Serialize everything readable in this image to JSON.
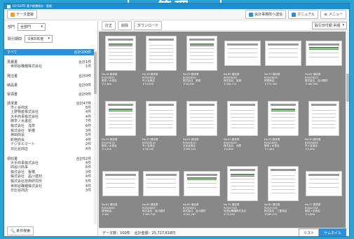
{
  "banner": {
    "title": "管理"
  },
  "window": {
    "title": "DX-SUITE 電子帳簿保存 - 管理"
  },
  "toolbar": {
    "register_label": "データ登録",
    "send_accounting_label": "会計事務所へ送信",
    "manual_label": "マニュアル",
    "menu_label": "メニュー"
  },
  "sidebar": {
    "dept_label": "部門",
    "dept_value": "全部門",
    "period_label": "取引期間",
    "period_value": "令和5年度",
    "all_label": "すべて",
    "all_count": "合計100件",
    "groups": [
      {
        "name": "見積書",
        "count": "合計1件",
        "items": [
          {
            "name": "世田谷職種株式会社",
            "count": "1件"
          }
        ]
      },
      {
        "name": "発注書",
        "count": "合計0件",
        "items": []
      },
      {
        "name": "納品書",
        "count": "合計0件",
        "items": []
      },
      {
        "name": "受領書",
        "count": "合計0件",
        "items": []
      },
      {
        "name": "請求書",
        "count": "合計47件",
        "items": [
          {
            "name": "市ヶ谷商店",
            "count": "8件"
          },
          {
            "name": "上野物産株式会社",
            "count": "4件"
          },
          {
            "name": "大手商事株式会社",
            "count": "4件"
          },
          {
            "name": "御茶ノ水書店",
            "count": "7件"
          },
          {
            "name": "株式会社　浅草",
            "count": "6件"
          },
          {
            "name": "株式会社　新橋",
            "count": "3件"
          },
          {
            "name": "神田商会",
            "count": "5件"
          },
          {
            "name": "新宿商会",
            "count": "4件"
          },
          {
            "name": "デジタルマート",
            "count": "2件"
          },
          {
            "name": "日比谷商店",
            "count": "4件"
          }
        ]
      },
      {
        "name": "領収書",
        "count": "合計52件",
        "items": [
          {
            "name": "大手商事株式会社",
            "count": "4件"
          },
          {
            "name": "四谷川商事",
            "count": "6件"
          },
          {
            "name": "株式会社　板橋",
            "count": "3件"
          },
          {
            "name": "株式会社　品川建材",
            "count": "4件"
          },
          {
            "name": "株式会社技術研究所",
            "count": "5件"
          },
          {
            "name": "世田谷職種株式会社",
            "count": "4件"
          },
          {
            "name": "日比谷商店",
            "count": "3件"
          }
        ]
      }
    ],
    "search_label": "条件検索"
  },
  "main": {
    "actions": [
      "訂正",
      "削除",
      "ダウンロード"
    ],
    "sort_value": "取引日付順 昇順",
    "docs": [
      {
        "no": "No.16 請求書",
        "date": "R05/08/31",
        "company": "御茶ノ水書店",
        "amount": "￥7,480",
        "landscape": false
      },
      {
        "no": "No.18 請求書",
        "date": "R05/08/31",
        "company": "市ヶ谷商店",
        "amount": "￥12,650",
        "landscape": false
      },
      {
        "no": "No.53 請求書",
        "date": "R05/08/30",
        "company": "株式会社　新橋",
        "amount": "￥18,000",
        "landscape": false
      },
      {
        "no": "No.69 領収書",
        "date": "R05/08/28",
        "company": "株式会社　板橋",
        "amount": "￥430,711",
        "landscape": true
      },
      {
        "no": "No.70 領収書",
        "date": "R05/08/28",
        "company": "神田商会",
        "amount": "￥775,500",
        "landscape": true
      },
      {
        "no": "No.82 領収書",
        "date": "R05/08/19",
        "company": "株式会社　品川建材",
        "amount": "￥180,000",
        "landscape": true
      },
      {
        "no": "No.20 請求書",
        "date": "R05/08/18",
        "company": "御茶ノ水書店",
        "amount": "￥3,300",
        "landscape": false
      },
      {
        "no": "No.27 請求書",
        "date": "R05/08/18",
        "company": "市ヶ谷商店",
        "amount": "￥18,000",
        "landscape": false
      },
      {
        "no": "No.41 請求書",
        "date": "R05/08/10",
        "company": "日比谷商店",
        "amount": "￥299,222",
        "landscape": false
      },
      {
        "no": "No.51 請求書",
        "date": "R05/08/09",
        "company": "株式会社　浅草",
        "amount": "￥6,600",
        "landscape": false
      },
      {
        "no": "No.25 請求書",
        "date": "R05/08/09",
        "company": "御茶ノ水書店",
        "amount": "￥7,480",
        "landscape": false
      },
      {
        "no": "No.30 請求書",
        "date": "R05/08/08",
        "company": "市ヶ谷商店",
        "amount": "￥5,000",
        "landscape": false
      },
      {
        "no": "No.61 領収書",
        "date": "R05/08/09",
        "company": "新宿商会",
        "amount": "￥330",
        "landscape": true
      },
      {
        "no": "No.64 領収書",
        "date": "R05/08/09",
        "company": "株式会社　品川建材",
        "amount": "￥405,718",
        "landscape": true
      },
      {
        "no": "No.60 領収書",
        "date": "R05/08/02",
        "company": "株式会社　品川建材",
        "amount": "￥161,787",
        "landscape": true
      },
      {
        "no": "No.75 領収書",
        "date": "R05/07/28",
        "company": "世田谷職種株式会社",
        "amount": "￥72,655",
        "landscape": false
      },
      {
        "no": "No.80 領収書",
        "date": "R05/07/28",
        "company": "株式会社　三菱商会",
        "amount": "￥280,070",
        "landscape": false
      },
      {
        "no": "No.37 請求書",
        "date": "R05/07/28",
        "company": "御茶ノ水書店",
        "amount": "￥4,686",
        "landscape": true
      }
    ]
  },
  "status": {
    "count_text": "データ数：100件",
    "total_text": "合計金額：25,727,818円",
    "list_label": "リスト",
    "thumb_label": "サムネイル"
  }
}
